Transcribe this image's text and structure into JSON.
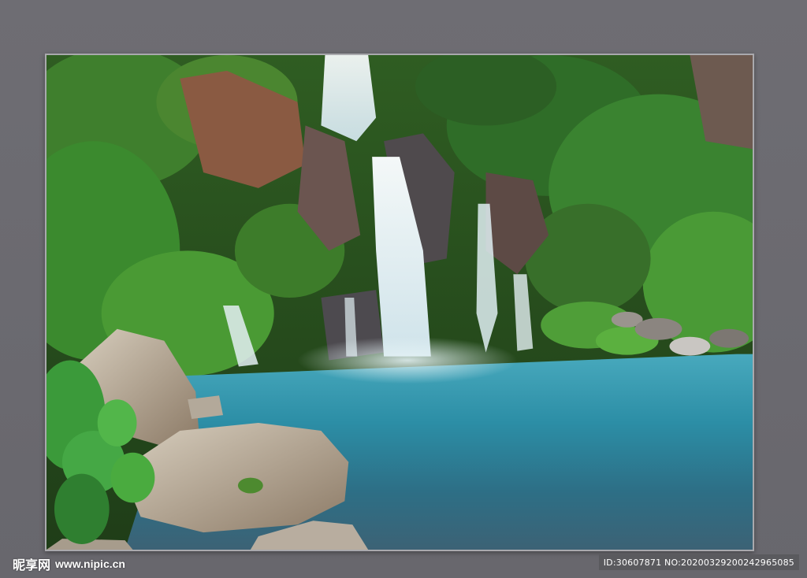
{
  "watermark": {
    "brand": "昵享网",
    "site": "www.nipic.cn",
    "id_line": "ID:30607871 NO:20200329200242965085"
  },
  "colors": {
    "background": "#6b6a70",
    "frame_border": "#a9a9ad",
    "water": "#2f8fa6",
    "foliage": "#2e7d2a"
  }
}
